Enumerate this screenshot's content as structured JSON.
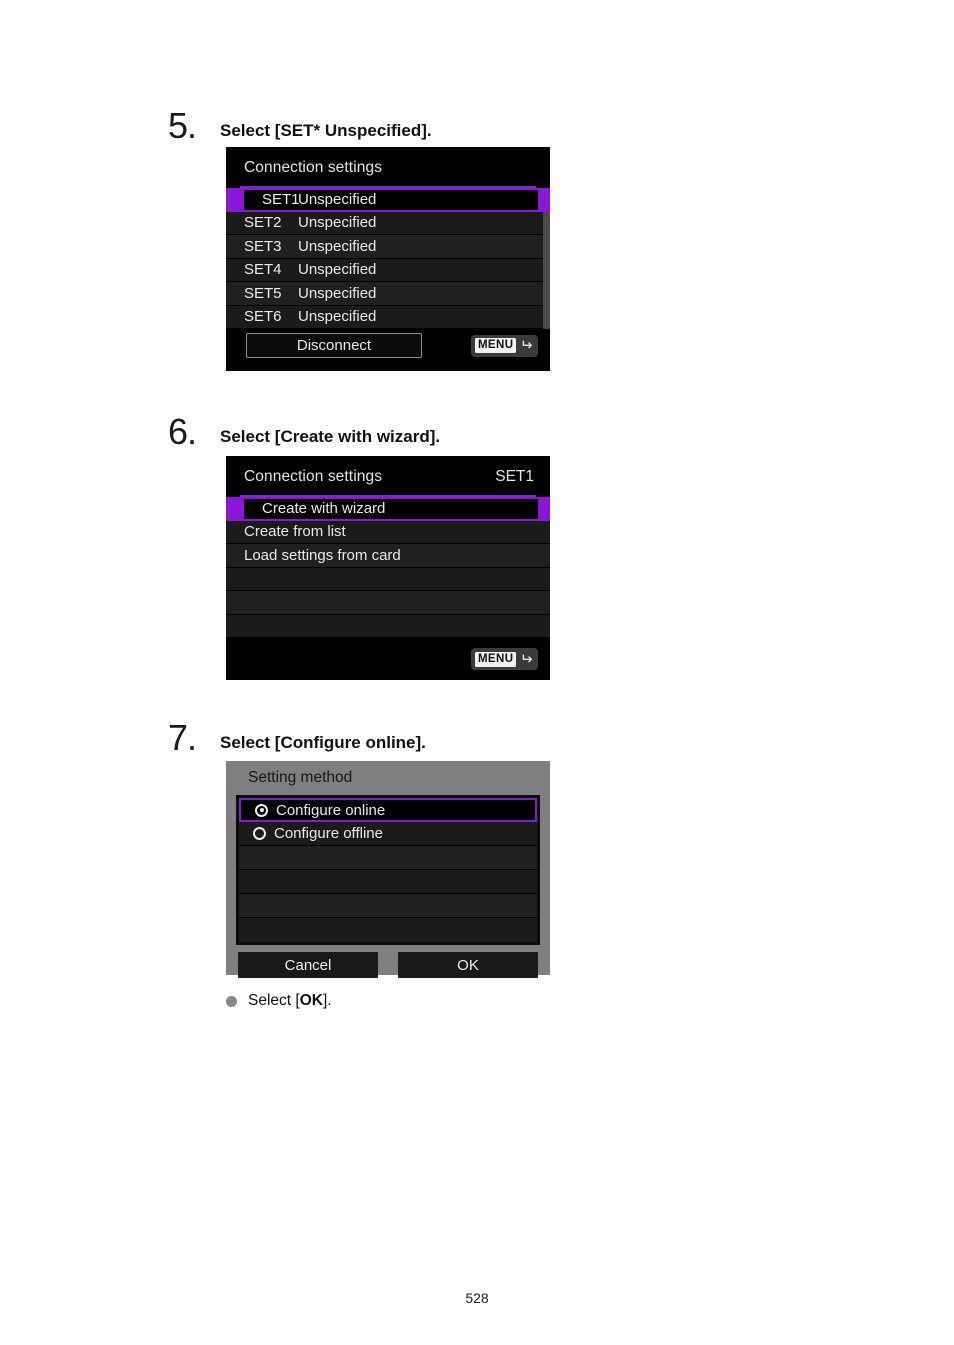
{
  "document": {
    "page_number": "528"
  },
  "steps": [
    {
      "number": "5.",
      "title": "Select [SET* Unspecified].",
      "screen": {
        "header_title": "Connection settings",
        "header_right": "",
        "rows": [
          {
            "key": "SET1",
            "value": "Unspecified",
            "selected": true
          },
          {
            "key": "SET2",
            "value": "Unspecified",
            "selected": false
          },
          {
            "key": "SET3",
            "value": "Unspecified",
            "selected": false
          },
          {
            "key": "SET4",
            "value": "Unspecified",
            "selected": false
          },
          {
            "key": "SET5",
            "value": "Unspecified",
            "selected": false
          },
          {
            "key": "SET6",
            "value": "Unspecified",
            "selected": false
          }
        ],
        "button_label": "Disconnect",
        "menu_label": "MENU",
        "menu_arrow": "↶"
      }
    },
    {
      "number": "6.",
      "title": "Select [Create with wizard].",
      "screen": {
        "header_title": "Connection settings",
        "header_right": "SET1",
        "rows": [
          {
            "key": "",
            "value": "Create with wizard",
            "selected": true
          },
          {
            "key": "",
            "value": "Create from list",
            "selected": false
          },
          {
            "key": "",
            "value": "Load settings from card",
            "selected": false
          },
          {
            "key": "",
            "value": "",
            "selected": false
          },
          {
            "key": "",
            "value": "",
            "selected": false
          },
          {
            "key": "",
            "value": "",
            "selected": false
          }
        ],
        "menu_label": "MENU",
        "menu_arrow": "↶"
      }
    },
    {
      "number": "7.",
      "title": "Select [Configure online].",
      "screen": {
        "header_title": "Setting method",
        "rows": [
          {
            "value": "Configure online",
            "radio": "checked",
            "selected": true
          },
          {
            "value": "Configure offline",
            "radio": "unchecked",
            "selected": false
          },
          {
            "value": "",
            "radio": "none",
            "selected": false
          },
          {
            "value": "",
            "radio": "none",
            "selected": false
          },
          {
            "value": "",
            "radio": "none",
            "selected": false
          },
          {
            "value": "",
            "radio": "none",
            "selected": false
          }
        ],
        "cancel_label": "Cancel",
        "ok_label": "OK"
      }
    }
  ],
  "note": {
    "prefix": "Select [",
    "bold": "OK",
    "suffix": "]."
  },
  "colors": {
    "accent_purple": "#8a17d6",
    "header_rule": "#7d2bc4",
    "lcd_background": "#000000",
    "row_background": "#1b1b1b",
    "dialog_gray": "#7f7f7f",
    "bullet_gray": "#8a8a8a"
  }
}
